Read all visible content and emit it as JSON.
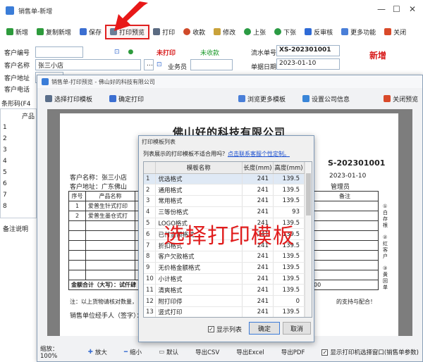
{
  "back_window": {
    "title": "销售单-新增",
    "toolbar": [
      "新增",
      "复制新增",
      "保存",
      "打印预览",
      "打印",
      "收款",
      "修改",
      "上张",
      "下张",
      "反审核",
      "更多功能",
      "关闭"
    ],
    "customer_no_label": "客户编号",
    "customer_name_label": "客户名称",
    "customer_name_value": "张三小店",
    "customer_addr_label": "客户地址",
    "customer_addr_value": "广东佛山",
    "customer_phone_label": "客户电话",
    "print_status": "未打印",
    "collect_status": "未收款",
    "serial_label": "流水单号",
    "serial_value": "XS-202301001",
    "date_label": "单据日期",
    "date_value": "2023-01-10",
    "salesman_label": "业务员",
    "status_badge": "新增",
    "barcode_label": "条形码(F4",
    "product_col": "产品",
    "row_numbers": [
      "1",
      "2",
      "3",
      "4",
      "5",
      "6",
      "7",
      "8"
    ],
    "remark_label": "备注说明"
  },
  "front_window": {
    "title": "销售单-打印预览 - 佛山好的科技有限公司",
    "toolbar": [
      "选择打印模板",
      "确定打印",
      "浏览更多模板",
      "设置公司信息",
      "关闭预览"
    ],
    "paper": {
      "company": "佛山好的科技有限公司",
      "serial_fragment": "S-202301001",
      "customer_name": "客户名称：张三小店",
      "customer_addr": "客户地址：广东佛山",
      "date_value": "2023-01-10",
      "manager_label": "管理员",
      "col_no": "序号",
      "col_product": "产品名称",
      "col_remark": "备注",
      "rows": [
        {
          "no": "1",
          "name": "爱普生针式打印",
          "tail": "00"
        },
        {
          "no": "2",
          "name": "爱普生墨仓式打",
          "tail": "00"
        }
      ],
      "total_label": "金额合计（大写）：试仟肆",
      "total_tail": "00",
      "note": "注：以上货物请核对数量，",
      "note_tail": "的支持与配合！",
      "signature": "销售单位经手人（签字）：",
      "side_copy_1": "①白存根",
      "side_copy_2": "②红客户",
      "side_copy_3": "③黄回单"
    },
    "status_bar": {
      "zoom": "缩放：100%",
      "zoom_in": "放大",
      "zoom_out": "缩小",
      "default": "默认",
      "export_csv": "导出CSV",
      "export_excel": "导出Excel",
      "export_pdf": "导出PDF",
      "show_window": "显示打印机选择窗口(销售单参数)"
    }
  },
  "dialog": {
    "title": "打印模板列表",
    "hint": "列表展示的打印模板不适合用吗？",
    "hint_link": "点击联系客服个性定制。",
    "headers": [
      "模板名称",
      "长度(mm)",
      "高度(mm)"
    ],
    "rows": [
      {
        "i": "1",
        "name": "优选格式",
        "len": "241",
        "h": "139.5"
      },
      {
        "i": "2",
        "name": "通用格式",
        "len": "241",
        "h": "139.5"
      },
      {
        "i": "3",
        "name": "常用格式",
        "len": "241",
        "h": "139.5"
      },
      {
        "i": "4",
        "name": "三等份格式",
        "len": "241",
        "h": "93"
      },
      {
        "i": "5",
        "name": "LOGO格式",
        "len": "241",
        "h": "139.5"
      },
      {
        "i": "6",
        "name": "已付金额格式",
        "len": "241",
        "h": "139.5"
      },
      {
        "i": "7",
        "name": "折扣格式",
        "len": "241",
        "h": "139.5"
      },
      {
        "i": "8",
        "name": "客户欠款格式",
        "len": "241",
        "h": "139.5"
      },
      {
        "i": "9",
        "name": "无价格金额格式",
        "len": "241",
        "h": "139.5"
      },
      {
        "i": "10",
        "name": "小计格式",
        "len": "241",
        "h": "139.5"
      },
      {
        "i": "11",
        "name": "清爽格式",
        "len": "241",
        "h": "139.5"
      },
      {
        "i": "12",
        "name": "附打印停",
        "len": "241",
        "h": "0"
      },
      {
        "i": "13",
        "name": "竖式打印",
        "len": "241",
        "h": "139.5"
      },
      {
        "i": "14",
        "name": "订单号格式",
        "len": "241",
        "h": "139.5"
      },
      {
        "i": "15",
        "name": "全部格式",
        "len": "241",
        "h": "139.5"
      }
    ],
    "show_list": "显示列表",
    "ok": "确定",
    "cancel": "取消"
  },
  "overlay": "选择打印模板"
}
